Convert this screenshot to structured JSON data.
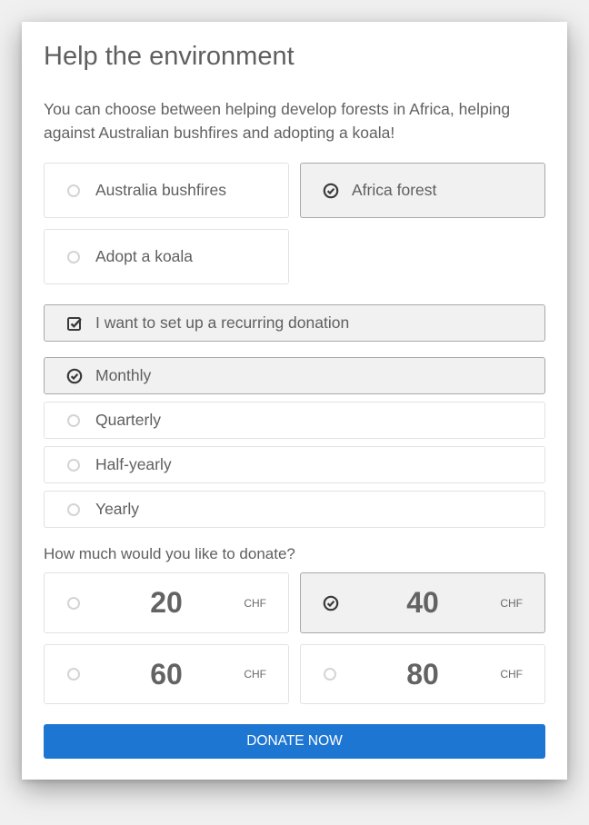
{
  "header": {
    "title": "Help the environment",
    "description": "You can choose between helping develop forests in Africa, helping against Australian bushfires and adopting a koala!"
  },
  "causes": [
    {
      "label": "Australia bushfires",
      "selected": false
    },
    {
      "label": "Africa forest",
      "selected": true
    },
    {
      "label": "Adopt a koala",
      "selected": false
    }
  ],
  "recurring": {
    "label": "I want to set up a recurring donation",
    "checked": true
  },
  "frequencies": [
    {
      "label": "Monthly",
      "selected": true
    },
    {
      "label": "Quarterly",
      "selected": false
    },
    {
      "label": "Half-yearly",
      "selected": false
    },
    {
      "label": "Yearly",
      "selected": false
    }
  ],
  "amount": {
    "question": "How much would you like to donate?",
    "currency": "CHF",
    "options": [
      {
        "value": "20",
        "selected": false
      },
      {
        "value": "40",
        "selected": true
      },
      {
        "value": "60",
        "selected": false
      },
      {
        "value": "80",
        "selected": false
      }
    ]
  },
  "donate_button": {
    "label": "DONATE NOW",
    "color": "#1e76d3"
  }
}
